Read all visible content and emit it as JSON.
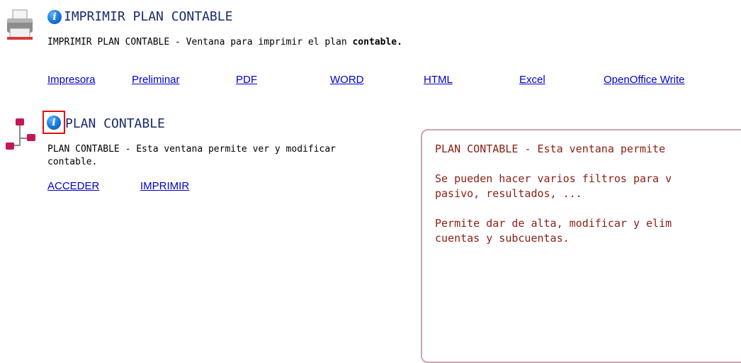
{
  "section_print": {
    "icon": "printer-icon",
    "title": "IMPRIMIR PLAN CONTABLE",
    "description_prefix": "IMPRIMIR PLAN CONTABLE - Ventana para imprimir el plan ",
    "description_bold": "contable.",
    "links": [
      "Impresora",
      "Preliminar",
      "PDF",
      "WORD",
      "HTML",
      "Excel",
      "OpenOffice Write"
    ]
  },
  "section_plan": {
    "icon": "org-chart-icon",
    "title": "PLAN CONTABLE",
    "description_line1": "PLAN CONTABLE - Esta ventana permite ver y modificar",
    "description_line2": "contable.",
    "links": [
      "ACCEDER",
      "IMPRIMIR"
    ]
  },
  "tooltip": {
    "line1": "PLAN CONTABLE - Esta ventana permite",
    "line2": "Se pueden hacer varios filtros para v",
    "line3": "pasivo, resultados, ...",
    "line4": "Permite dar de alta, modificar y elim",
    "line5": "cuentas y subcuentas."
  },
  "colors": {
    "title": "#1a2a6e",
    "link": "#0000cc",
    "tooltip_text": "#8a1e12",
    "tooltip_border": "#c8a6ad",
    "highlight_box": "#e01010"
  }
}
